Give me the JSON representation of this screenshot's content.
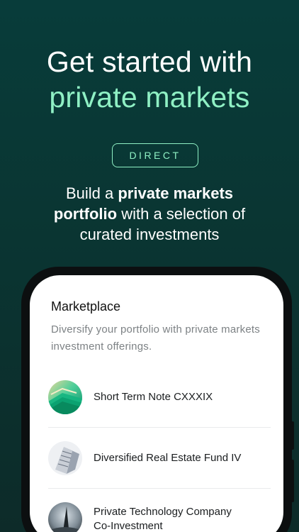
{
  "hero": {
    "title_line1": "Get started with",
    "title_line2": "private markets",
    "badge": "DIRECT",
    "subtitle_pre": "Build a ",
    "subtitle_bold1": "private markets",
    "subtitle_bold2": "portfolio",
    "subtitle_post": " with a selection of",
    "subtitle_line3": "curated investments"
  },
  "marketplace": {
    "title": "Marketplace",
    "description": "Diversify your portfolio with private markets investment offerings.",
    "items": [
      {
        "label": "Short Term Note CXXXIX",
        "icon": "layers-thumbnail"
      },
      {
        "label": "Diversified Real Estate Fund IV",
        "icon": "building-thumbnail"
      },
      {
        "label_line1": "Private Technology Company",
        "label_line2": "Co-Investment",
        "icon": "tower-thumbnail"
      }
    ]
  },
  "colors": {
    "accent": "#8ff0c4",
    "background": "#0a3532"
  }
}
